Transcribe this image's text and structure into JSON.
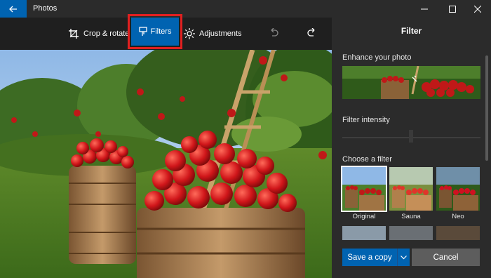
{
  "window": {
    "title": "Photos",
    "back_icon": "arrow-left-icon",
    "minimize_icon": "minimize-icon",
    "maximize_icon": "maximize-icon",
    "close_icon": "close-icon"
  },
  "toolbar": {
    "crop_label": "Crop & rotate",
    "filters_label": "Filters",
    "adjustments_label": "Adjustments",
    "undo_icon": "undo-icon",
    "redo_icon": "redo-icon",
    "active_tab": "Filters",
    "highlight_color": "#e02020",
    "accent": "#0063b1"
  },
  "panel": {
    "title": "Filter",
    "enhance_label": "Enhance your photo",
    "intensity_label": "Filter intensity",
    "choose_label": "Choose a filter",
    "filters": [
      {
        "label": "Original",
        "selected": true
      },
      {
        "label": "Sauna",
        "selected": false
      },
      {
        "label": "Neo",
        "selected": false
      }
    ],
    "save_label": "Save a copy",
    "cancel_label": "Cancel"
  }
}
